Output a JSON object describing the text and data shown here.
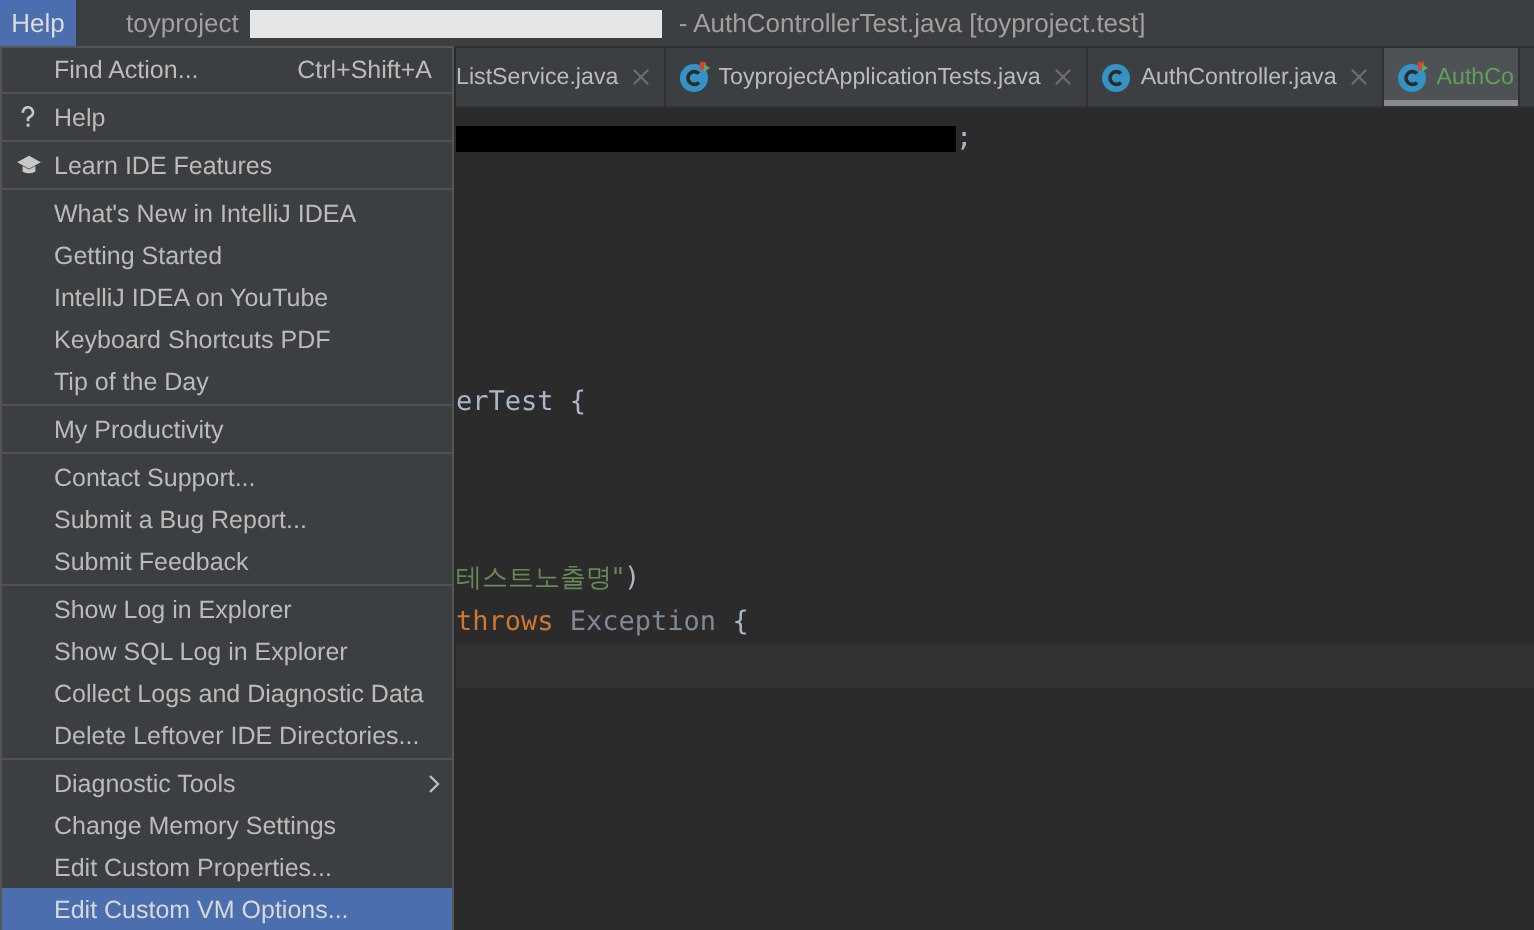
{
  "menu_bar": {
    "active_menu": {
      "label": "Help",
      "selected": true
    }
  },
  "window": {
    "project": "toyproject",
    "title": "- AuthControllerTest.java [toyproject.test]"
  },
  "tabs": [
    {
      "label": "ListService.java",
      "kind": "plain",
      "selected": false
    },
    {
      "label": "ToyprojectApplicationTests.java",
      "kind": "test",
      "selected": false
    },
    {
      "label": "AuthController.java",
      "kind": "class",
      "selected": false
    },
    {
      "label": "AuthCo",
      "kind": "test",
      "selected": true
    }
  ],
  "code_lines": [
    {
      "kind": "code",
      "tokens": [
        {
          "kind": "redacted"
        },
        {
          "kind": "plain",
          "text": ";"
        }
      ]
    },
    {
      "kind": "blank"
    },
    {
      "kind": "blank"
    },
    {
      "kind": "blank"
    },
    {
      "kind": "blank"
    },
    {
      "kind": "blank"
    },
    {
      "kind": "code",
      "tokens": [
        {
          "kind": "plain",
          "text": "erTest {"
        }
      ]
    },
    {
      "kind": "blank"
    },
    {
      "kind": "blank"
    },
    {
      "kind": "blank"
    },
    {
      "kind": "code",
      "tokens": [
        {
          "kind": "string",
          "text": "테스트노출명\""
        },
        {
          "kind": "plain",
          "text": ")"
        }
      ]
    },
    {
      "kind": "code",
      "tokens": [
        {
          "kind": "keyword",
          "text": "throws "
        },
        {
          "kind": "type",
          "text": "Exception "
        },
        {
          "kind": "plain",
          "text": "{"
        }
      ]
    },
    {
      "kind": "caret_line"
    }
  ],
  "menu": {
    "groups": [
      {
        "items": [
          {
            "label": "Find Action...",
            "shortcut": "Ctrl+Shift+A",
            "kind": "action",
            "selected": false
          }
        ]
      },
      {
        "items": [
          {
            "label": "Help",
            "kind": "help",
            "selected": false
          }
        ]
      },
      {
        "items": [
          {
            "label": "Learn IDE Features",
            "kind": "learn",
            "selected": false
          }
        ]
      },
      {
        "items": [
          {
            "label": "What's New in IntelliJ IDEA",
            "kind": "action",
            "selected": false
          },
          {
            "label": "Getting Started",
            "kind": "action",
            "selected": false
          },
          {
            "label": "IntelliJ IDEA on YouTube",
            "kind": "action",
            "selected": false
          },
          {
            "label": "Keyboard Shortcuts PDF",
            "kind": "action",
            "selected": false
          },
          {
            "label": "Tip of the Day",
            "kind": "action",
            "selected": false
          }
        ]
      },
      {
        "items": [
          {
            "label": "My Productivity",
            "kind": "action",
            "selected": false
          }
        ]
      },
      {
        "items": [
          {
            "label": "Contact Support...",
            "kind": "action",
            "selected": false
          },
          {
            "label": "Submit a Bug Report...",
            "kind": "action",
            "selected": false
          },
          {
            "label": "Submit Feedback",
            "kind": "action",
            "selected": false
          }
        ]
      },
      {
        "items": [
          {
            "label": "Show Log in Explorer",
            "kind": "action",
            "selected": false
          },
          {
            "label": "Show SQL Log in Explorer",
            "kind": "action",
            "selected": false
          },
          {
            "label": "Collect Logs and Diagnostic Data",
            "kind": "action",
            "selected": false
          },
          {
            "label": "Delete Leftover IDE Directories...",
            "kind": "action",
            "selected": false
          }
        ]
      },
      {
        "items": [
          {
            "label": "Diagnostic Tools",
            "kind": "submenu",
            "selected": false
          },
          {
            "label": "Change Memory Settings",
            "kind": "action",
            "selected": false
          },
          {
            "label": "Edit Custom Properties...",
            "kind": "action",
            "selected": false
          },
          {
            "label": "Edit Custom VM Options...",
            "kind": "action",
            "selected": true
          }
        ]
      }
    ]
  }
}
